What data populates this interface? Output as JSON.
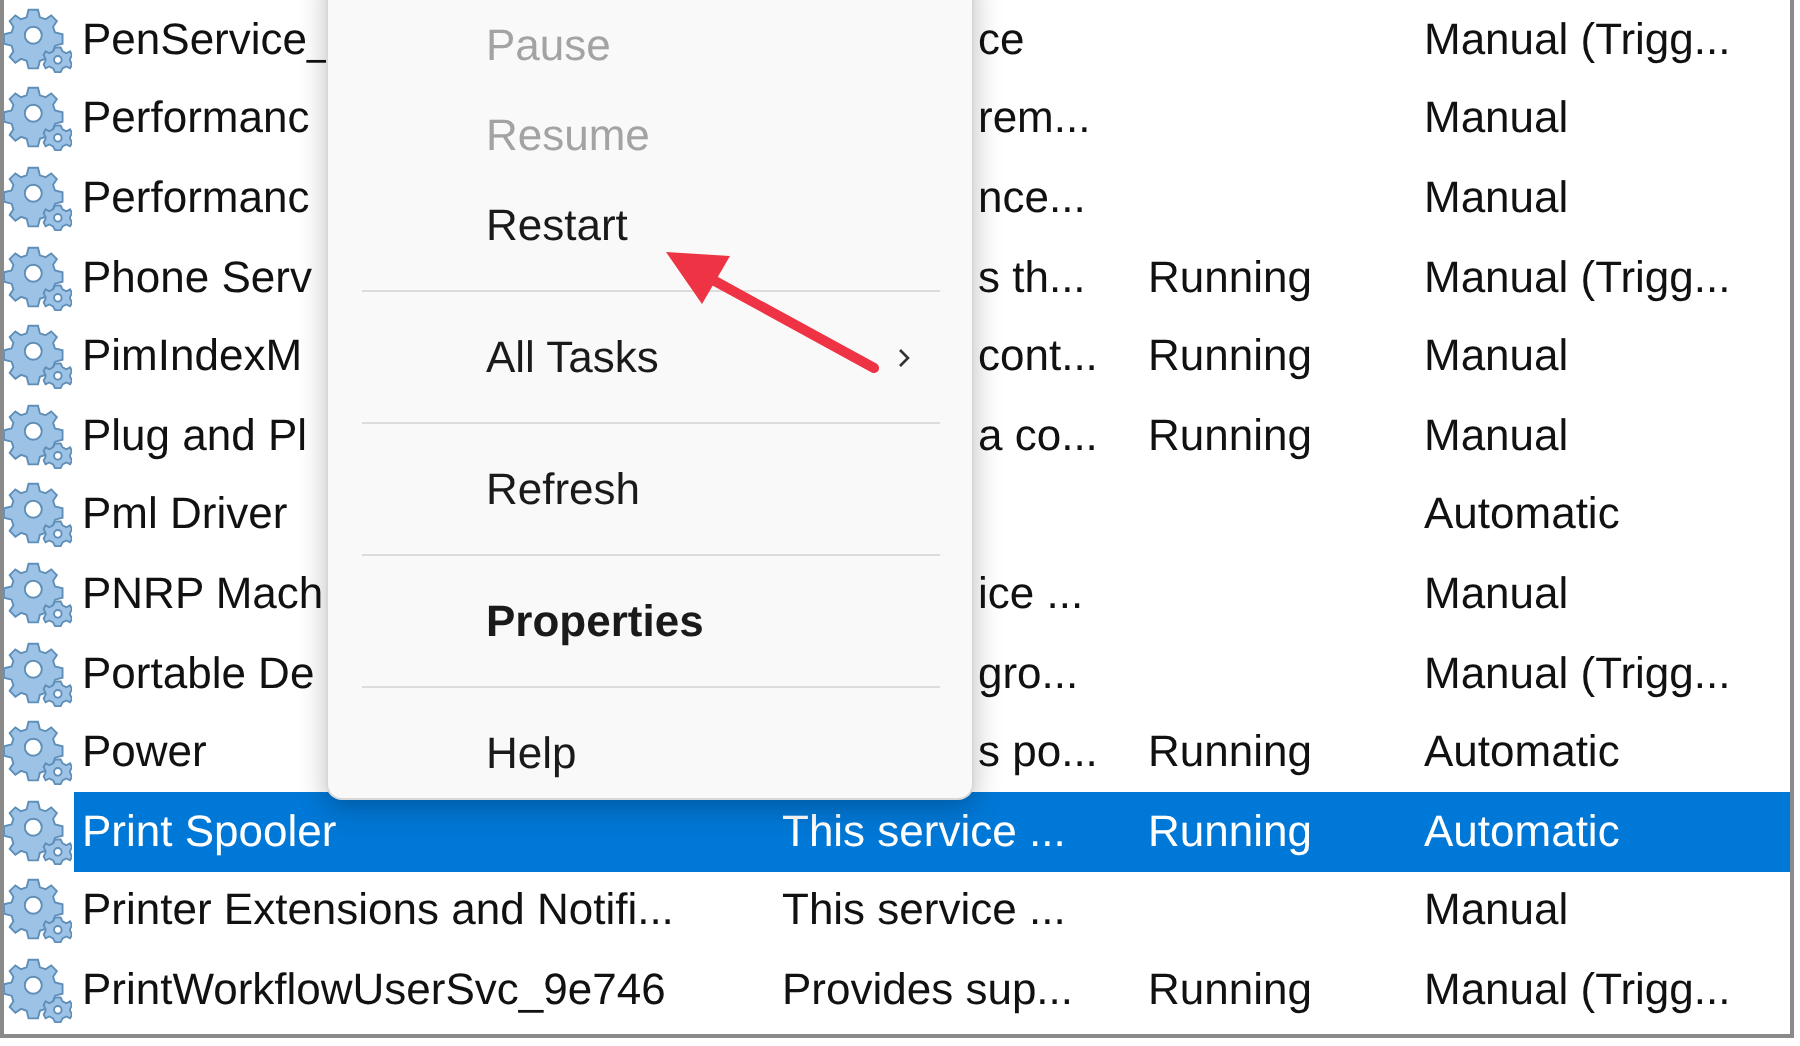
{
  "services": {
    "rows": [
      {
        "name": "PenService_",
        "description": "ce",
        "startup": "Manual (Trigg...",
        "selected": false
      },
      {
        "name": "Performanc",
        "description": "rem...",
        "startup": "Manual",
        "selected": false
      },
      {
        "name": "Performanc",
        "description": "nce...",
        "startup": "Manual",
        "selected": false
      },
      {
        "name": "Phone Serv",
        "description": "s th...",
        "status": "Running",
        "startup": "Manual (Trigg...",
        "selected": false
      },
      {
        "name": "PimIndexM",
        "description": "cont...",
        "status": "Running",
        "startup": "Manual",
        "selected": false
      },
      {
        "name": "Plug and Pl",
        "description": "a co...",
        "status": "Running",
        "startup": "Manual",
        "selected": false
      },
      {
        "name": "Pml Driver",
        "startup": "Automatic",
        "selected": false
      },
      {
        "name": "PNRP Mach",
        "description": "ice ...",
        "startup": "Manual",
        "selected": false
      },
      {
        "name": "Portable De",
        "description": "gro...",
        "startup": "Manual (Trigg...",
        "selected": false
      },
      {
        "name": "Power",
        "description": "s po...",
        "status": "Running",
        "startup": "Automatic",
        "selected": false
      },
      {
        "name": "Print Spooler",
        "description": "This service ...",
        "status": "Running",
        "startup": "Automatic",
        "selected": true
      },
      {
        "name": "Printer Extensions and Notifi...",
        "description": "This service ...",
        "startup": "Manual",
        "selected": false
      },
      {
        "name": "PrintWorkflowUserSvc_9e746",
        "description": "Provides sup...",
        "status": "Running",
        "startup": "Manual (Trigg...",
        "selected": false
      }
    ]
  },
  "context_menu": {
    "items": [
      {
        "kind": "item",
        "label": "Pause",
        "disabled": true,
        "bold": false,
        "submenu": false
      },
      {
        "kind": "item",
        "label": "Resume",
        "disabled": true,
        "bold": false,
        "submenu": false
      },
      {
        "kind": "item",
        "label": "Restart",
        "disabled": false,
        "bold": false,
        "submenu": false
      },
      {
        "kind": "separator"
      },
      {
        "kind": "item",
        "label": "All Tasks",
        "disabled": false,
        "bold": false,
        "submenu": true
      },
      {
        "kind": "separator"
      },
      {
        "kind": "item",
        "label": "Refresh",
        "disabled": false,
        "bold": false,
        "submenu": false
      },
      {
        "kind": "separator"
      },
      {
        "kind": "item",
        "label": "Properties",
        "disabled": false,
        "bold": true,
        "submenu": false
      },
      {
        "kind": "separator"
      },
      {
        "kind": "item",
        "label": "Help",
        "disabled": false,
        "bold": false,
        "submenu": false
      }
    ]
  }
}
